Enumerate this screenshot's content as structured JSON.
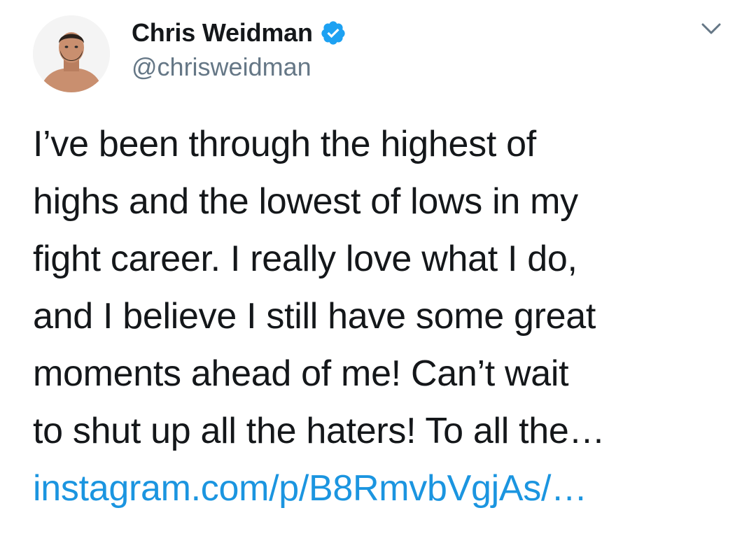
{
  "author": {
    "display_name": "Chris Weidman",
    "handle": "@chrisweidman",
    "verified": true,
    "verified_icon": "verified-badge-icon"
  },
  "menu": {
    "icon": "chevron-down-icon"
  },
  "tweet": {
    "lines": [
      "I’ve been through the highest of",
      "highs and the lowest of lows in my",
      "fight career. I really love what I do,",
      "and I believe I still have some great",
      "moments ahead of me! Can’t wait",
      "to shut up all the haters! To all the…"
    ],
    "link_text": "instagram.com/p/B8RmvbVgjAs/…"
  },
  "colors": {
    "text": "#14171a",
    "secondary": "#657786",
    "link": "#1b95e0",
    "verified": "#1da1f2"
  }
}
